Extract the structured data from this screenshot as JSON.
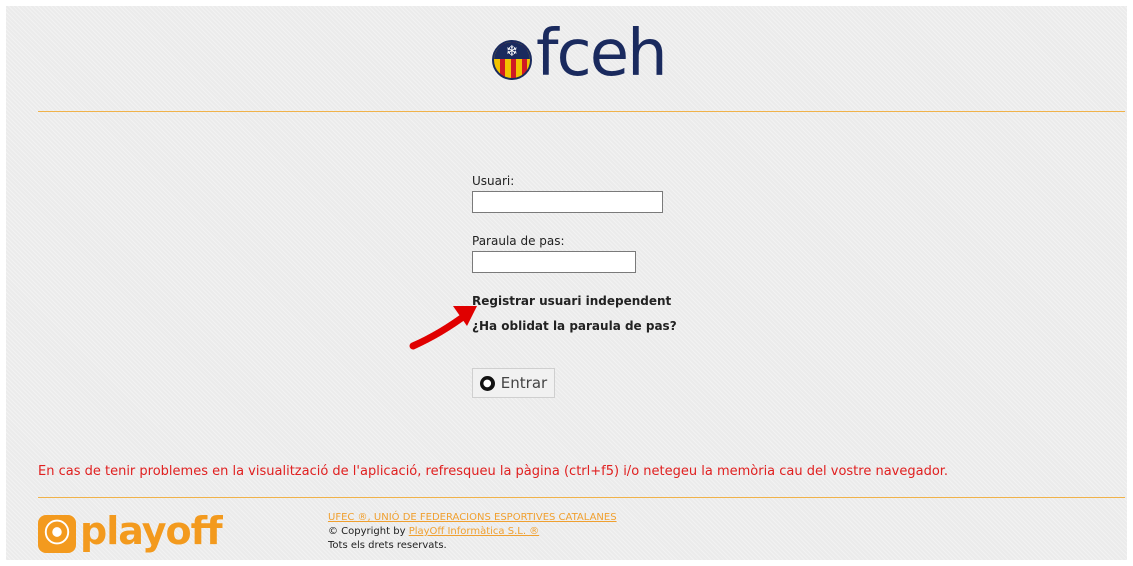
{
  "brand": {
    "logo_text": "fceh",
    "emblem_icon": "snowflake-emblem-icon"
  },
  "login": {
    "username_label": "Usuari:",
    "username_value": "",
    "password_label": "Paraula de pas:",
    "password_value": "",
    "register_link": "Registrar usuari independent",
    "forgot_link": "¿Ha oblidat la paraula de pas?",
    "submit_label": "Entrar",
    "submit_icon": "keyhole-icon"
  },
  "annotation": {
    "arrow_color": "#e00000"
  },
  "warning_text": "En cas de tenir problemes en la visualització de l'aplicació, refresqueu la pàgina (ctrl+f5) i/o netegeu la memòria cau del vostre navegador.",
  "footer": {
    "playoff_logo": "playoff",
    "federation_link": "UFEC ®, UNIÓ DE FEDERACIONS ESPORTIVES CATALANES",
    "copyright_prefix": "© Copyright by",
    "company_link": "PlayOff Informàtica S.L. ®",
    "rights": "Tots els drets reservats."
  },
  "colors": {
    "brand_navy": "#1a2a5e",
    "accent_orange": "#f0b24a",
    "warning_red": "#e02020",
    "playoff_orange": "#f39a1e"
  }
}
